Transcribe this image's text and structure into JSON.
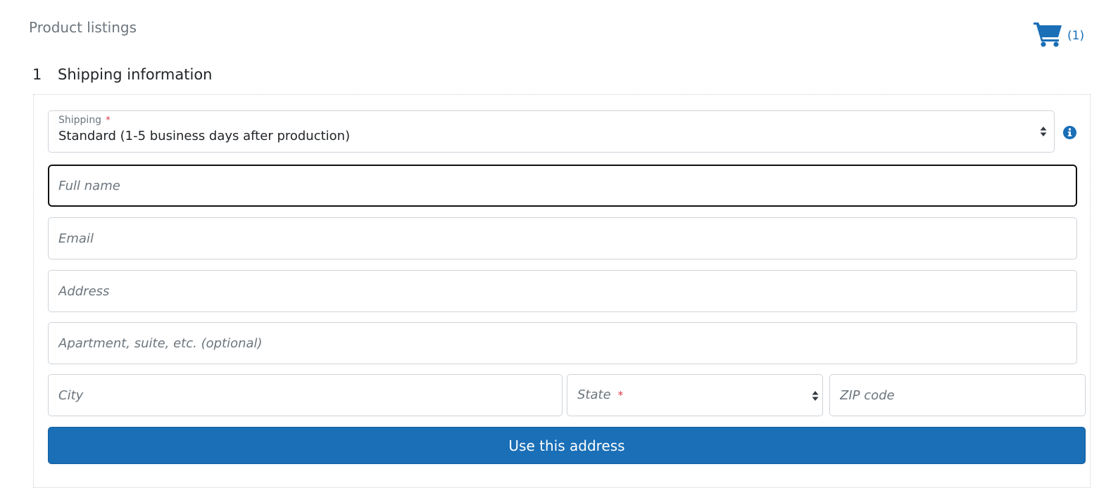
{
  "header": {
    "breadcrumb": "Product listings",
    "cart_count": "(1)",
    "cart_icon": "shopping-cart-icon",
    "accent_color": "#1a6fb7"
  },
  "step": {
    "number": "1",
    "title": "Shipping information"
  },
  "form": {
    "shipping": {
      "label": "Shipping",
      "required_mark": "*",
      "selected_value": "Standard (1-5 business days after production)"
    },
    "full_name_placeholder": "Full name",
    "email_placeholder": "Email",
    "address_placeholder": "Address",
    "apartment_placeholder": "Apartment, suite, etc. (optional)",
    "city_placeholder": "City",
    "state": {
      "placeholder": "State",
      "required_mark": "*"
    },
    "zip_placeholder": "ZIP code",
    "submit_label": "Use this address"
  }
}
